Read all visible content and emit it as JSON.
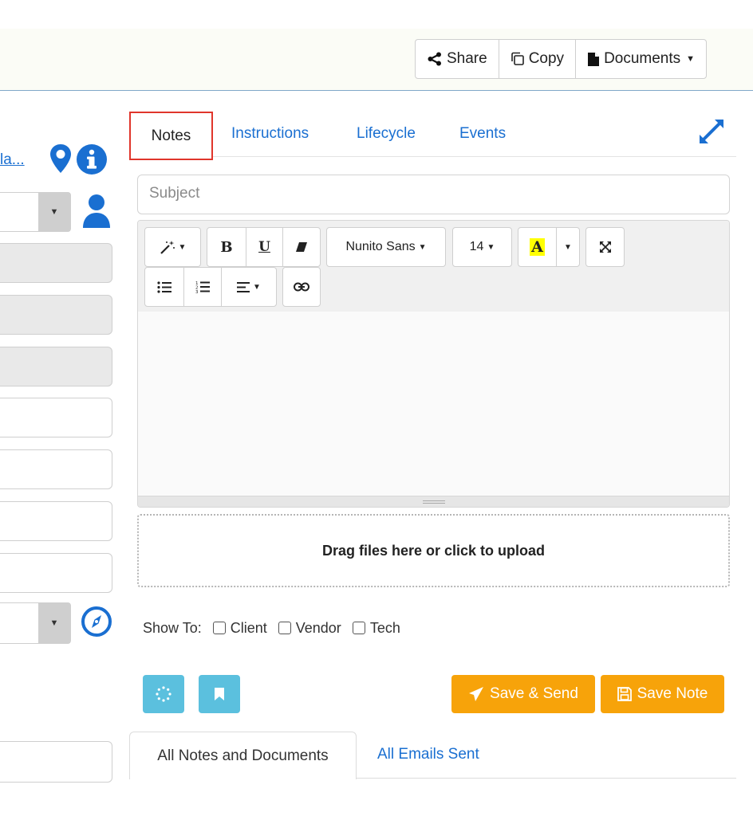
{
  "header": {
    "share_label": "Share",
    "copy_label": "Copy",
    "documents_label": "Documents"
  },
  "left_panel": {
    "truncated_link": "la..."
  },
  "tabs": [
    {
      "label": "Notes",
      "active": true
    },
    {
      "label": "Instructions"
    },
    {
      "label": "Lifecycle"
    },
    {
      "label": "Events"
    }
  ],
  "note_form": {
    "subject_placeholder": "Subject",
    "toolbar": {
      "font_family": "Nunito Sans",
      "font_size": "14",
      "bold": "B",
      "underline": "U",
      "highlight_letter": "A"
    },
    "dropzone_text": "Drag files here or click to upload",
    "show_to_label": "Show To:",
    "show_to_options": [
      {
        "label": "Client",
        "checked": false
      },
      {
        "label": "Vendor",
        "checked": false
      },
      {
        "label": "Tech",
        "checked": false
      }
    ],
    "save_send_label": "Save & Send",
    "save_note_label": "Save Note"
  },
  "bottom_tabs": [
    {
      "label": "All Notes and Documents",
      "active": true
    },
    {
      "label": "All Emails Sent"
    }
  ],
  "colors": {
    "link": "#1a6fd1",
    "accent_orange": "#f7a30a",
    "accent_info": "#5bc0de",
    "highlight_box": "#e0352b"
  }
}
